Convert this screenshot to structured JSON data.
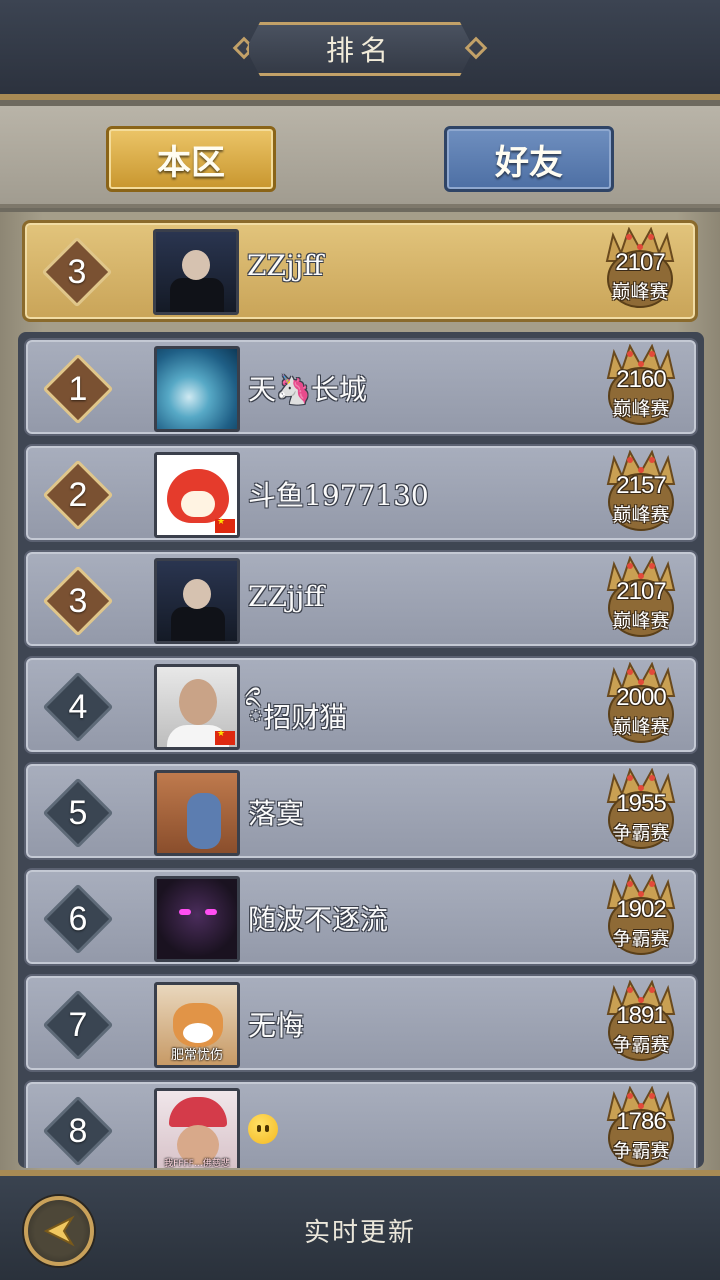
{
  "header": {
    "title": "排名"
  },
  "tabs": [
    {
      "label": "本区",
      "active": true
    },
    {
      "label": "好友",
      "active": false
    }
  ],
  "my_entry": {
    "rank": "3",
    "name": "ZZjjff",
    "score": "2107",
    "tier": "巅峰赛",
    "avatar": "suit-man-avatar"
  },
  "entries": [
    {
      "rank": "1",
      "name": "天🦄长城",
      "score": "2160",
      "tier": "巅峰赛",
      "avatar": "wave",
      "caption": ""
    },
    {
      "rank": "2",
      "name": "斗鱼1977130",
      "score": "2157",
      "tier": "巅峰赛",
      "avatar": "fox",
      "caption": ""
    },
    {
      "rank": "3",
      "name": "ZZjjff",
      "score": "2107",
      "tier": "巅峰赛",
      "avatar": "suit",
      "caption": ""
    },
    {
      "rank": "4",
      "name": "ིྀ招财猫",
      "score": "2000",
      "tier": "巅峰赛",
      "avatar": "man",
      "caption": ""
    },
    {
      "rank": "5",
      "name": "落寞",
      "score": "1955",
      "tier": "争霸赛",
      "avatar": "kid",
      "caption": ""
    },
    {
      "rank": "6",
      "name": "随波不逐流",
      "score": "1902",
      "tier": "争霸赛",
      "avatar": "demon",
      "caption": ""
    },
    {
      "rank": "7",
      "name": "无悔",
      "score": "1891",
      "tier": "争霸赛",
      "avatar": "cat",
      "caption": "肥常忧伤"
    },
    {
      "rank": "8",
      "name": "",
      "score": "1786",
      "tier": "争霸赛",
      "avatar": "crown",
      "caption": "我FFFF…佛慈悲"
    }
  ],
  "footer": {
    "refresh_label": "实时更新",
    "back_icon": "back-arrow-icon"
  },
  "colors": {
    "gold_tab": "#d8aa44",
    "blue_tab": "#5b7cb0",
    "top_rank_diamond": "#7a5132",
    "normal_rank_diamond": "#3a4552",
    "row_bg": "#9ea4b3"
  }
}
